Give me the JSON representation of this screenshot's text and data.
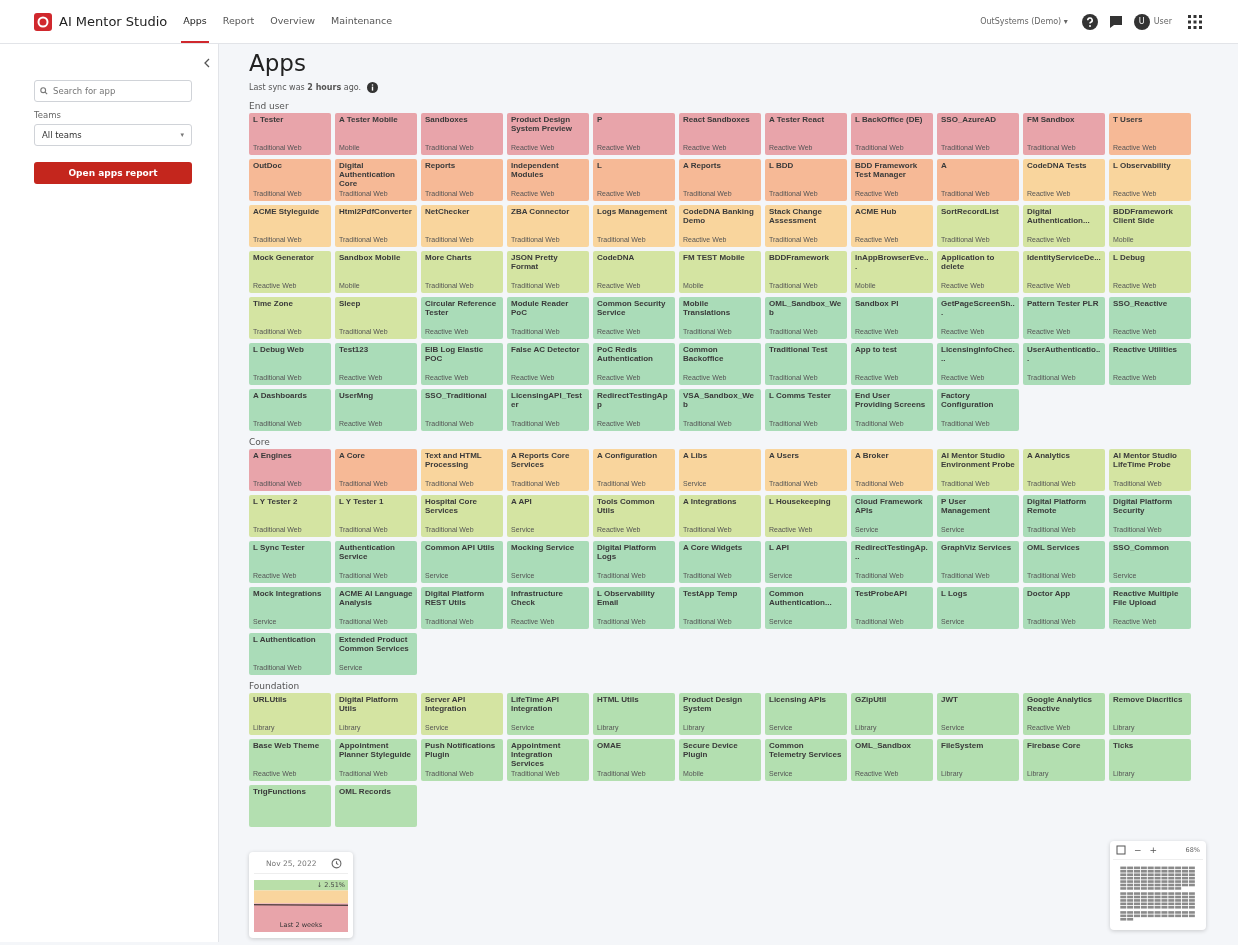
{
  "header": {
    "product": "AI Mentor Studio",
    "nav": [
      {
        "label": "Apps",
        "selected": true
      },
      {
        "label": "Report",
        "selected": false
      },
      {
        "label": "Overview",
        "selected": false
      },
      {
        "label": "Maintenance",
        "selected": false
      }
    ],
    "tenant": "OutSystems (Demo)",
    "tenant_caret": "▾",
    "avatar": "U",
    "user": "User"
  },
  "sidebar": {
    "search": {
      "placeholder": "Search for app"
    },
    "teams_label": "Teams",
    "teams_value": "All teams",
    "teams_caret": "▾",
    "report_button": "Open apps report"
  },
  "page": {
    "title": "Apps",
    "sync": "Last sync was **2 hours** ago."
  },
  "groups": [
    {
      "title": "End user",
      "apps": [
        {
          "name": "L Tester",
          "type": "Traditional Web",
          "color": "#e8a4aa"
        },
        {
          "name": "A Tester Mobile",
          "type": "Mobile",
          "color": "#e8a4aa"
        },
        {
          "name": "Sandboxes",
          "type": "Traditional Web",
          "color": "#e8a4aa"
        },
        {
          "name": "Product Design System Preview",
          "type": "Reactive Web",
          "color": "#e8a4aa"
        },
        {
          "name": "P",
          "type": "Reactive Web",
          "color": "#e8a4aa"
        },
        {
          "name": "React Sandboxes",
          "type": "Reactive Web",
          "color": "#e8a4aa"
        },
        {
          "name": "A Tester React",
          "type": "Reactive Web",
          "color": "#e8a4aa"
        },
        {
          "name": "L BackOffice (DE)",
          "type": "Traditional Web",
          "color": "#e8a4aa"
        },
        {
          "name": "SSO_AzureAD",
          "type": "Traditional Web",
          "color": "#e8a4aa"
        },
        {
          "name": "FM Sandbox",
          "type": "Traditional Web",
          "color": "#e8a4aa"
        },
        {
          "name": "T Users",
          "type": "Reactive Web",
          "color": "#f6b996"
        },
        {
          "name": "OutDoc",
          "type": "Traditional Web",
          "color": "#f6b996"
        },
        {
          "name": "Digital Authentication Core",
          "type": "Traditional Web",
          "color": "#f6b996"
        },
        {
          "name": "Reports",
          "type": "Traditional Web",
          "color": "#f6b996"
        },
        {
          "name": "Independent Modules",
          "type": "Reactive Web",
          "color": "#f6b996"
        },
        {
          "name": "L",
          "type": "Reactive Web",
          "color": "#f6b996"
        },
        {
          "name": "A Reports",
          "type": "Traditional Web",
          "color": "#f6b996"
        },
        {
          "name": "L BDD",
          "type": "Traditional Web",
          "color": "#f6b996"
        },
        {
          "name": "BDD Framework Test Manager",
          "type": "Reactive Web",
          "color": "#f6b996"
        },
        {
          "name": "A",
          "type": "Traditional Web",
          "color": "#f6b996"
        },
        {
          "name": "CodeDNA Tests",
          "type": "Reactive Web",
          "color": "#f9d59d"
        },
        {
          "name": "L Observability",
          "type": "Reactive Web",
          "color": "#f9d59d"
        },
        {
          "name": "ACME Styleguide",
          "type": "Traditional Web",
          "color": "#f9d59d"
        },
        {
          "name": "Html2PdfConverter",
          "type": "Traditional Web",
          "color": "#f9d59d"
        },
        {
          "name": "NetChecker",
          "type": "Traditional Web",
          "color": "#f9d59d"
        },
        {
          "name": "ZBA Connector",
          "type": "Traditional Web",
          "color": "#f9d59d"
        },
        {
          "name": "Logs Management",
          "type": "Traditional Web",
          "color": "#f9d59d"
        },
        {
          "name": "CodeDNA Banking Demo",
          "type": "Reactive Web",
          "color": "#f9d59d"
        },
        {
          "name": "Stack Change Assessment",
          "type": "Traditional Web",
          "color": "#f9d59d"
        },
        {
          "name": "ACME Hub",
          "type": "Reactive Web",
          "color": "#f9d59d"
        },
        {
          "name": "SortRecordList",
          "type": "Traditional Web",
          "color": "#d4e4a2"
        },
        {
          "name": "Digital Authentication...",
          "type": "Reactive Web",
          "color": "#d4e4a2"
        },
        {
          "name": "BDDFramework Client Side",
          "type": "Mobile",
          "color": "#d4e4a2"
        },
        {
          "name": "Mock Generator",
          "type": "Reactive Web",
          "color": "#d4e4a2"
        },
        {
          "name": "Sandbox Mobile",
          "type": "Mobile",
          "color": "#d4e4a2"
        },
        {
          "name": "More Charts",
          "type": "Traditional Web",
          "color": "#d4e4a2"
        },
        {
          "name": "JSON Pretty Format",
          "type": "Traditional Web",
          "color": "#d4e4a2"
        },
        {
          "name": "CodeDNA",
          "type": "Reactive Web",
          "color": "#d4e4a2"
        },
        {
          "name": "FM TEST Mobile",
          "type": "Mobile",
          "color": "#d4e4a2"
        },
        {
          "name": "BDDFramework",
          "type": "Traditional Web",
          "color": "#d4e4a2"
        },
        {
          "name": "InAppBrowserEve...",
          "type": "Mobile",
          "color": "#d4e4a2"
        },
        {
          "name": "Application to delete",
          "type": "Reactive Web",
          "color": "#d4e4a2"
        },
        {
          "name": "IdentityServiceDe...",
          "type": "Reactive Web",
          "color": "#d4e4a2"
        },
        {
          "name": "L Debug",
          "type": "Reactive Web",
          "color": "#d4e4a2"
        },
        {
          "name": "Time Zone",
          "type": "Traditional Web",
          "color": "#d4e4a2"
        },
        {
          "name": "Sleep",
          "type": "Traditional Web",
          "color": "#d4e4a2"
        },
        {
          "name": "Circular Reference Tester",
          "type": "Reactive Web",
          "color": "#aadcb8"
        },
        {
          "name": "Module Reader PoC",
          "type": "Traditional Web",
          "color": "#aadcb8"
        },
        {
          "name": "Common Security Service",
          "type": "Reactive Web",
          "color": "#aadcb8"
        },
        {
          "name": "Mobile Translations",
          "type": "Traditional Web",
          "color": "#aadcb8"
        },
        {
          "name": "OML_Sandbox_Web",
          "type": "Traditional Web",
          "color": "#aadcb8"
        },
        {
          "name": "Sandbox PI",
          "type": "Reactive Web",
          "color": "#aadcb8"
        },
        {
          "name": "GetPageScreenSh...",
          "type": "Reactive Web",
          "color": "#aadcb8"
        },
        {
          "name": "Pattern Tester PLR",
          "type": "Reactive Web",
          "color": "#aadcb8"
        },
        {
          "name": "SSO_Reactive",
          "type": "Reactive Web",
          "color": "#aadcb8"
        },
        {
          "name": "L Debug Web",
          "type": "Traditional Web",
          "color": "#aadcb8"
        },
        {
          "name": "Test123",
          "type": "Reactive Web",
          "color": "#aadcb8"
        },
        {
          "name": "EIB Log Elastic POC",
          "type": "Reactive Web",
          "color": "#aadcb8"
        },
        {
          "name": "False AC Detector",
          "type": "Reactive Web",
          "color": "#aadcb8"
        },
        {
          "name": "PoC Redis Authentication",
          "type": "Reactive Web",
          "color": "#aadcb8"
        },
        {
          "name": "Common Backoffice",
          "type": "Reactive Web",
          "color": "#aadcb8"
        },
        {
          "name": "Traditional Test",
          "type": "Traditional Web",
          "color": "#aadcb8"
        },
        {
          "name": "App to test",
          "type": "Reactive Web",
          "color": "#aadcb8"
        },
        {
          "name": "LicensingInfoChec...",
          "type": "Reactive Web",
          "color": "#aadcb8"
        },
        {
          "name": "UserAuthenticatio...",
          "type": "Traditional Web",
          "color": "#aadcb8"
        },
        {
          "name": "Reactive Utilities",
          "type": "Reactive Web",
          "color": "#aadcb8"
        },
        {
          "name": "A Dashboards",
          "type": "Traditional Web",
          "color": "#aadcb8"
        },
        {
          "name": "UserMng",
          "type": "Reactive Web",
          "color": "#aadcb8"
        },
        {
          "name": "SSO_Traditional",
          "type": "Traditional Web",
          "color": "#aadcb8"
        },
        {
          "name": "LicensingAPI_Tester",
          "type": "Traditional Web",
          "color": "#aadcb8"
        },
        {
          "name": "RedirectTestingApp",
          "type": "Reactive Web",
          "color": "#aadcb8"
        },
        {
          "name": "VSA_Sandbox_Web",
          "type": "Traditional Web",
          "color": "#aadcb8"
        },
        {
          "name": "L Comms Tester",
          "type": "Traditional Web",
          "color": "#aadcb8"
        },
        {
          "name": "End User Providing Screens",
          "type": "Traditional Web",
          "color": "#aadcb8"
        },
        {
          "name": "Factory Configuration",
          "type": "Traditional Web",
          "color": "#aadcb8"
        }
      ]
    },
    {
      "title": "Core",
      "apps": [
        {
          "name": "A Engines",
          "type": "Traditional Web",
          "color": "#e8a4aa"
        },
        {
          "name": "A Core",
          "type": "Traditional Web",
          "color": "#f6b996"
        },
        {
          "name": "Text and HTML Processing",
          "type": "Traditional Web",
          "color": "#f9d59d"
        },
        {
          "name": "A Reports Core Services",
          "type": "Traditional Web",
          "color": "#f9d59d"
        },
        {
          "name": "A Configuration",
          "type": "Traditional Web",
          "color": "#f9d59d"
        },
        {
          "name": "A Libs",
          "type": "Service",
          "color": "#f9d59d"
        },
        {
          "name": "A Users",
          "type": "Traditional Web",
          "color": "#f9d59d"
        },
        {
          "name": "A Broker",
          "type": "Traditional Web",
          "color": "#f9d59d"
        },
        {
          "name": "AI Mentor Studio Environment Probe",
          "type": "Traditional Web",
          "color": "#d4e4a2"
        },
        {
          "name": "A Analytics",
          "type": "Traditional Web",
          "color": "#d4e4a2"
        },
        {
          "name": "AI Mentor Studio LifeTime Probe",
          "type": "Traditional Web",
          "color": "#d4e4a2"
        },
        {
          "name": "L Y Tester 2",
          "type": "Traditional Web",
          "color": "#d4e4a2"
        },
        {
          "name": "L Y Tester 1",
          "type": "Traditional Web",
          "color": "#d4e4a2"
        },
        {
          "name": "Hospital Core Services",
          "type": "Traditional Web",
          "color": "#d4e4a2"
        },
        {
          "name": "A API",
          "type": "Service",
          "color": "#d4e4a2"
        },
        {
          "name": "Tools Common Utils",
          "type": "Reactive Web",
          "color": "#d4e4a2"
        },
        {
          "name": "A Integrations",
          "type": "Traditional Web",
          "color": "#d4e4a2"
        },
        {
          "name": "L Housekeeping",
          "type": "Reactive Web",
          "color": "#d4e4a2"
        },
        {
          "name": "Cloud Framework APIs",
          "type": "Service",
          "color": "#aadcb8"
        },
        {
          "name": "P User Management",
          "type": "Service",
          "color": "#aadcb8"
        },
        {
          "name": "Digital Platform Remote",
          "type": "Traditional Web",
          "color": "#aadcb8"
        },
        {
          "name": "Digital Platform Security",
          "type": "Traditional Web",
          "color": "#aadcb8"
        },
        {
          "name": "L Sync Tester",
          "type": "Reactive Web",
          "color": "#aadcb8"
        },
        {
          "name": "Authentication Service",
          "type": "Traditional Web",
          "color": "#aadcb8"
        },
        {
          "name": "Common API Utils",
          "type": "Service",
          "color": "#aadcb8"
        },
        {
          "name": "Mocking Service",
          "type": "Service",
          "color": "#aadcb8"
        },
        {
          "name": "Digital Platform Logs",
          "type": "Traditional Web",
          "color": "#aadcb8"
        },
        {
          "name": "A Core Widgets",
          "type": "Traditional Web",
          "color": "#aadcb8"
        },
        {
          "name": "L API",
          "type": "Service",
          "color": "#aadcb8"
        },
        {
          "name": "RedirectTestingAp...",
          "type": "Traditional Web",
          "color": "#aadcb8"
        },
        {
          "name": "GraphViz Services",
          "type": "Traditional Web",
          "color": "#aadcb8"
        },
        {
          "name": "OML Services",
          "type": "Traditional Web",
          "color": "#aadcb8"
        },
        {
          "name": "SSO_Common",
          "type": "Service",
          "color": "#aadcb8"
        },
        {
          "name": "Mock Integrations",
          "type": "Service",
          "color": "#aadcb8"
        },
        {
          "name": "ACME AI Language Analysis",
          "type": "Traditional Web",
          "color": "#aadcb8"
        },
        {
          "name": "Digital Platform REST Utils",
          "type": "Traditional Web",
          "color": "#aadcb8"
        },
        {
          "name": "Infrastructure Check",
          "type": "Reactive Web",
          "color": "#aadcb8"
        },
        {
          "name": "L Observability Email",
          "type": "Traditional Web",
          "color": "#aadcb8"
        },
        {
          "name": "TestApp Temp",
          "type": "Traditional Web",
          "color": "#aadcb8"
        },
        {
          "name": "Common Authentication...",
          "type": "Service",
          "color": "#aadcb8"
        },
        {
          "name": "TestProbeAPI",
          "type": "Traditional Web",
          "color": "#aadcb8"
        },
        {
          "name": "L Logs",
          "type": "Service",
          "color": "#aadcb8"
        },
        {
          "name": "Doctor App",
          "type": "Traditional Web",
          "color": "#aadcb8"
        },
        {
          "name": "Reactive Multiple File Upload",
          "type": "Reactive Web",
          "color": "#aadcb8"
        },
        {
          "name": "L Authentication",
          "type": "Traditional Web",
          "color": "#aadcb8"
        },
        {
          "name": "Extended Product Common Services",
          "type": "Service",
          "color": "#aadcb8"
        }
      ]
    },
    {
      "title": "Foundation",
      "apps": [
        {
          "name": "URLUtils",
          "type": "Library",
          "color": "#d4e4a2"
        },
        {
          "name": "Digital Platform Utils",
          "type": "Library",
          "color": "#d4e4a2"
        },
        {
          "name": "Server API Integration",
          "type": "Service",
          "color": "#d4e4a2"
        },
        {
          "name": "LifeTime API Integration",
          "type": "Service",
          "color": "#b3dfb0"
        },
        {
          "name": "HTML Utils",
          "type": "Library",
          "color": "#b3dfb0"
        },
        {
          "name": "Product Design System",
          "type": "Library",
          "color": "#b3dfb0"
        },
        {
          "name": "Licensing APIs",
          "type": "Service",
          "color": "#b3dfb0"
        },
        {
          "name": "GZipUtil",
          "type": "Library",
          "color": "#b3dfb0"
        },
        {
          "name": "JWT",
          "type": "Service",
          "color": "#b3dfb0"
        },
        {
          "name": "Google Analytics Reactive",
          "type": "Reactive Web",
          "color": "#b3dfb0"
        },
        {
          "name": "Remove Diacritics",
          "type": "Library",
          "color": "#b3dfb0"
        },
        {
          "name": "Base Web Theme",
          "type": "Reactive Web",
          "color": "#b3dfb0"
        },
        {
          "name": "Appointment Planner Styleguide",
          "type": "Traditional Web",
          "color": "#b3dfb0"
        },
        {
          "name": "Push Notifications Plugin",
          "type": "Traditional Web",
          "color": "#b3dfb0"
        },
        {
          "name": "Appointment Integration Services",
          "type": "Traditional Web",
          "color": "#b3dfb0"
        },
        {
          "name": "OMAE",
          "type": "Traditional Web",
          "color": "#b3dfb0"
        },
        {
          "name": "Secure Device Plugin",
          "type": "Mobile",
          "color": "#b3dfb0"
        },
        {
          "name": "Common Telemetry Services",
          "type": "Service",
          "color": "#b3dfb0"
        },
        {
          "name": "OML_Sandbox",
          "type": "Reactive Web",
          "color": "#b3dfb0"
        },
        {
          "name": "FileSystem",
          "type": "Library",
          "color": "#b3dfb0"
        },
        {
          "name": "Firebase Core",
          "type": "Library",
          "color": "#b3dfb0"
        },
        {
          "name": "Ticks",
          "type": "Library",
          "color": "#b3dfb0"
        },
        {
          "name": "TrigFunctions",
          "color": "#b3dfb0"
        },
        {
          "name": "OML Records",
          "color": "#b3dfb0"
        }
      ]
    }
  ],
  "timeline": {
    "date": "Nov 25, 2022",
    "change": "↓ 2.51%",
    "period": "Last 2 weeks"
  },
  "minimap": {
    "zoom_out": "−",
    "zoom_in": "+",
    "zoom": "68%"
  }
}
